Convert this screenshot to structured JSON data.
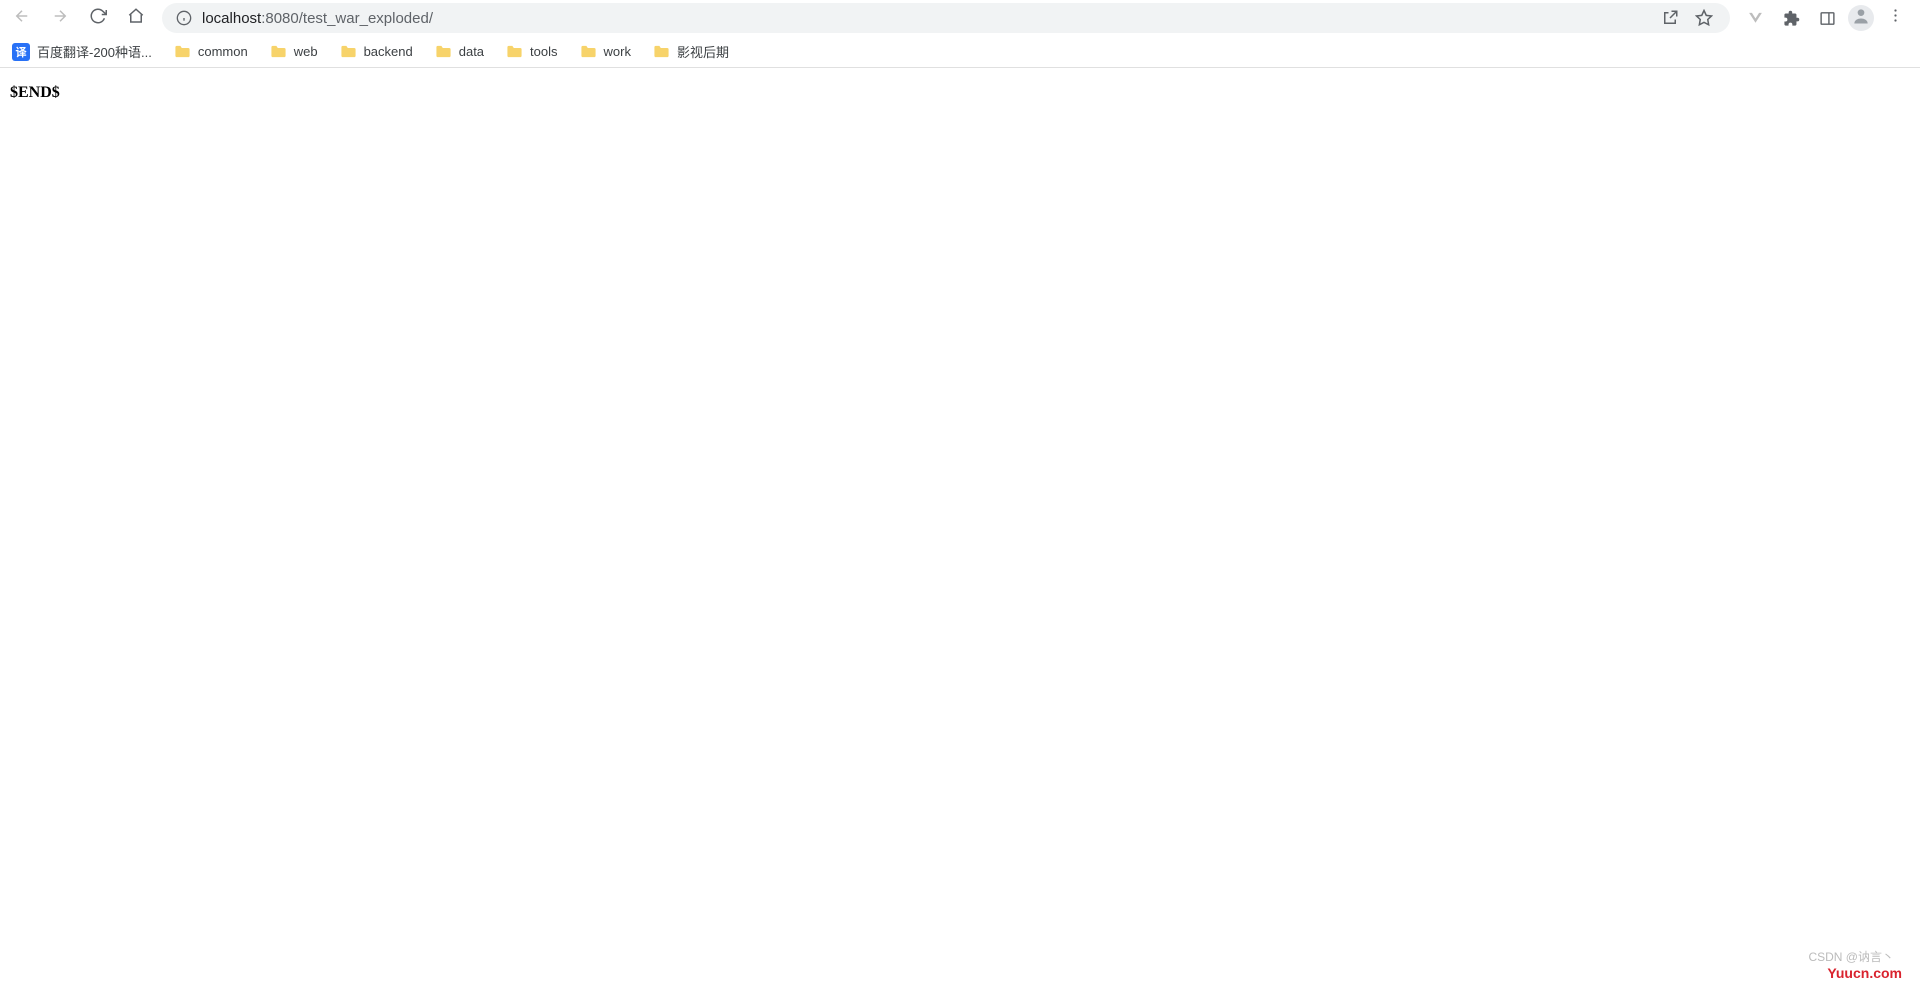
{
  "nav": {
    "url_host": "localhost",
    "url_port": ":8080",
    "url_path": "/test_war_exploded/"
  },
  "bookmarks": [
    {
      "type": "site",
      "label": "百度翻译-200种语..."
    },
    {
      "type": "folder",
      "label": "common"
    },
    {
      "type": "folder",
      "label": "web"
    },
    {
      "type": "folder",
      "label": "backend"
    },
    {
      "type": "folder",
      "label": "data"
    },
    {
      "type": "folder",
      "label": "tools"
    },
    {
      "type": "folder",
      "label": "work"
    },
    {
      "type": "folder",
      "label": "影视后期"
    }
  ],
  "page": {
    "body_text": "$END$"
  },
  "watermark": {
    "csdn": "CSDN @讷言丶",
    "yuucn": "Yuucn.com"
  },
  "icons": {
    "baidu_badge": "译"
  }
}
